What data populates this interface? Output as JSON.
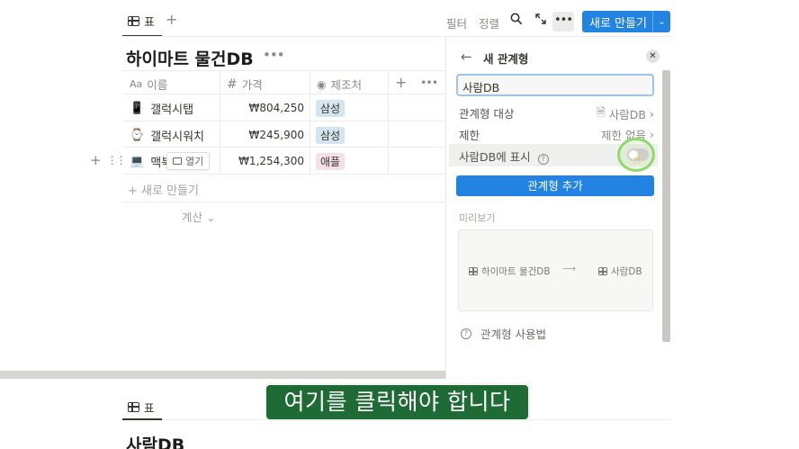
{
  "toolbar": {
    "view_tab_label": "표",
    "add_view_icon": "+",
    "filter_label": "필터",
    "sort_label": "정렬",
    "more_label": "•••",
    "new_button_label": "새로 만들기",
    "new_button_caret": "⌄"
  },
  "database": {
    "title": "하이마트 물건DB",
    "title_more": "•••",
    "columns": [
      {
        "icon": "Aa",
        "label": "이름"
      },
      {
        "icon": "#",
        "label": "가격"
      },
      {
        "icon": "◉",
        "label": "제조처"
      }
    ],
    "add_column": "+",
    "column_more": "•••",
    "rows": [
      {
        "icon": "📱",
        "name": "갤럭시탭",
        "price": "₩804,250",
        "maker": "삼성",
        "maker_color": "#d3e5ef"
      },
      {
        "icon": "⌚",
        "name": "갤럭시워치",
        "price": "₩245,900",
        "maker": "삼성",
        "maker_color": "#d3e5ef"
      },
      {
        "icon": "💻",
        "name": "맥북",
        "price": "₩1,254,300",
        "maker": "애플",
        "maker_color": "#f5e0e9"
      }
    ],
    "open_label": "열기",
    "new_row_label": "+ 새로 만들기",
    "calc_label": "계산 ⌄"
  },
  "relation_panel": {
    "title": "새 관계형",
    "input_value": "사람DB",
    "target_label": "관계형 대상",
    "target_value": "사람DB",
    "limit_label": "제한",
    "limit_value": "제한 없음",
    "show_on_label": "사람DB에 표시",
    "show_on_enabled": false,
    "add_button_label": "관계형 추가",
    "preview_label": "미리보기",
    "preview_from": "하이마트 물건DB",
    "preview_arrow": "⟶",
    "preview_to": "사람DB",
    "howto_label": "관계형 사용법"
  },
  "bottom": {
    "view_tab_label": "표",
    "title": "사람DB"
  },
  "caption": "여기를 클릭해야 합니다",
  "colors": {
    "accent": "#2383e2",
    "caption_bg": "#1e6b35",
    "highlight_ring": "#8fd86a"
  }
}
